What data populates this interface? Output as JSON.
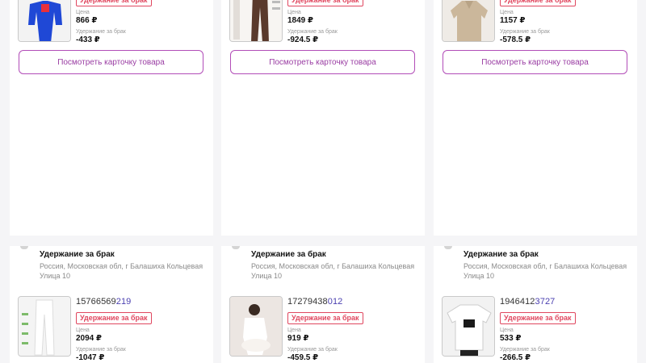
{
  "labels": {
    "price": "Цена",
    "hold": "Удержание за брак",
    "badge": "Удержание за брак",
    "button": "Посмотреть карточку товара"
  },
  "top_cards": [
    {
      "price": "866 ₽",
      "hold": "-433 ₽"
    },
    {
      "price": "1849 ₽",
      "hold": "-924.5 ₽"
    },
    {
      "price": "1157 ₽",
      "hold": "-578.5 ₽"
    }
  ],
  "bottom_cards": [
    {
      "title": "Удержание за брак",
      "address": "Россия, Московская обл, г Балашиха Кольцевая Улица 10",
      "id_prefix": "15766569",
      "id_suffix": "219",
      "price": "2094 ₽",
      "hold": "-1047 ₽"
    },
    {
      "title": "Удержание за брак",
      "address": "Россия, Московская обл, г Балашиха Кольцевая Улица 10",
      "id_prefix": "17279438",
      "id_suffix": "012",
      "price": "919 ₽",
      "hold": "-459.5 ₽"
    },
    {
      "title": "Удержание за брак",
      "address": "Россия, Московская обл, г Балашиха Кольцевая Улица 10",
      "id_prefix": "1946412",
      "id_suffix": "3727",
      "price": "533 ₽",
      "hold": "-266.5 ₽"
    }
  ],
  "colors": {
    "accent": "#9a3da3",
    "badge": "#e0475f",
    "id_highlight": "#4a3fb0"
  },
  "icons": [
    "blue-tracksuit-image",
    "brown-pants-image",
    "beige-polo-image",
    "white-pants-image",
    "white-outfit-image",
    "white-tshirt-image"
  ]
}
